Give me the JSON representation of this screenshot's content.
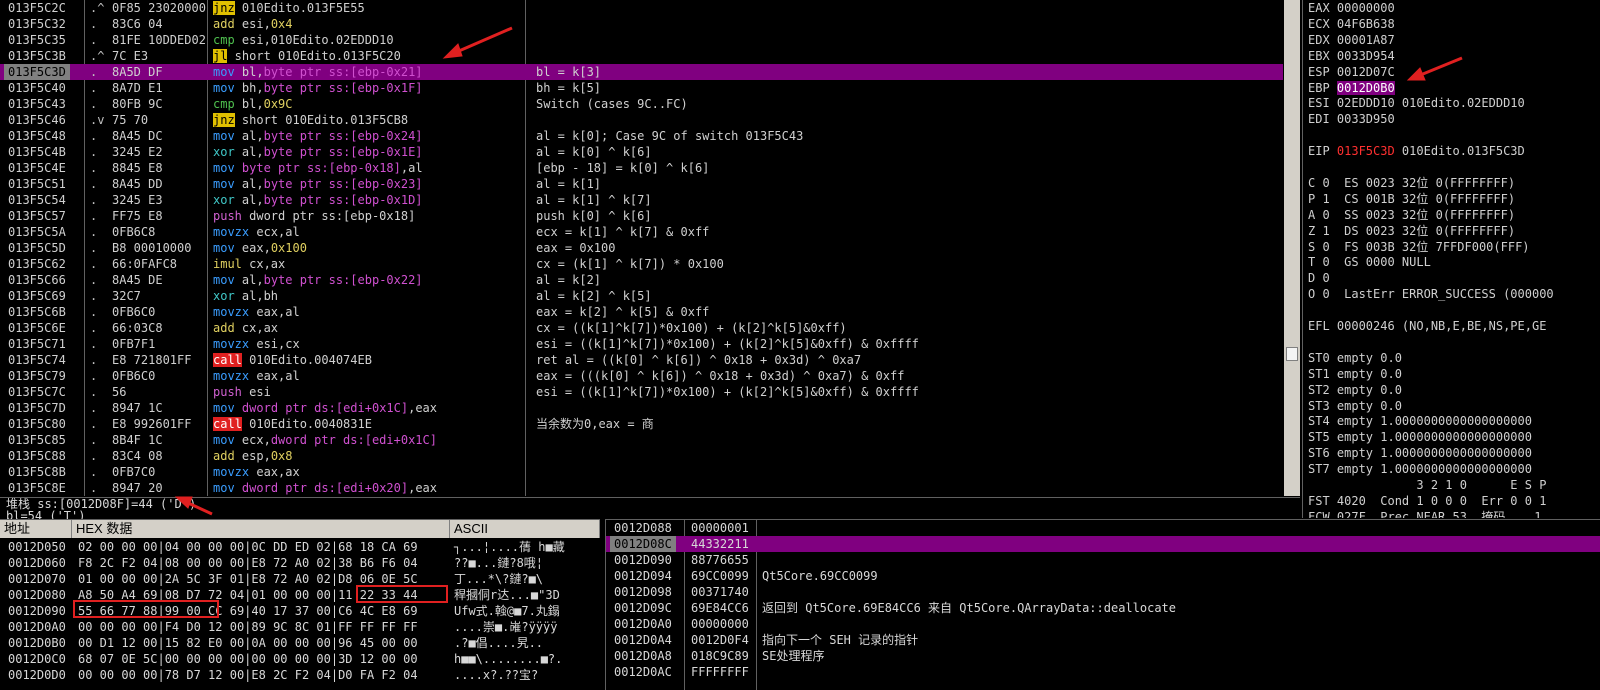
{
  "disasm": {
    "rows": [
      {
        "addr": "013F5C2C",
        "mark": ".^",
        "hex": "0F85 23020000",
        "asm": [
          [
            "jnz",
            "jmp"
          ],
          [
            " 010Edito.013F5E55",
            ""
          ]
        ],
        "cmt": ""
      },
      {
        "addr": "013F5C32",
        "mark": ".",
        "hex": "83C6 04",
        "asm": [
          [
            "add",
            "add"
          ],
          [
            " esi,",
            ""
          ],
          [
            "0x4",
            "imm"
          ]
        ],
        "cmt": ""
      },
      {
        "addr": "013F5C35",
        "mark": ".",
        "hex": "81FE 10DDED02",
        "asm": [
          [
            "cmp",
            "cmp"
          ],
          [
            " esi,010Edito.02EDDD10",
            ""
          ]
        ],
        "cmt": ""
      },
      {
        "addr": "013F5C3B",
        "mark": ".^",
        "hex": "7C E3",
        "asm": [
          [
            "jl",
            "jmp"
          ],
          [
            " short 010Edito.013F5C20",
            ""
          ]
        ],
        "cmt": ""
      },
      {
        "addr": "013F5C3D",
        "mark": ".",
        "hex": "8A5D DF",
        "asm": [
          [
            "mov",
            "mov"
          ],
          [
            " bl,",
            ""
          ],
          [
            "byte ptr ss:[ebp-0x21]",
            "ptr"
          ]
        ],
        "cmt": "bl = k[3]",
        "sel": true
      },
      {
        "addr": "013F5C40",
        "mark": ".",
        "hex": "8A7D E1",
        "asm": [
          [
            "mov",
            "mov"
          ],
          [
            " bh,",
            ""
          ],
          [
            "byte ptr ss:[ebp-0x1F]",
            "ptr"
          ]
        ],
        "cmt": "bh = k[5]"
      },
      {
        "addr": "013F5C43",
        "mark": ".",
        "hex": "80FB 9C",
        "asm": [
          [
            "cmp",
            "cmp"
          ],
          [
            " bl,",
            ""
          ],
          [
            "0x9C",
            "imm"
          ]
        ],
        "cmt": "Switch (cases 9C..FC)"
      },
      {
        "addr": "013F5C46",
        "mark": ".v",
        "hex": "75 70",
        "asm": [
          [
            "jnz",
            "jmp"
          ],
          [
            " short 010Edito.013F5CB8",
            ""
          ]
        ],
        "cmt": ""
      },
      {
        "addr": "013F5C48",
        "mark": ".",
        "hex": "8A45 DC",
        "asm": [
          [
            "mov",
            "mov"
          ],
          [
            " al,",
            ""
          ],
          [
            "byte ptr ss:[ebp-0x24]",
            "ptr"
          ]
        ],
        "cmt": "al = k[0]; Case 9C of switch 013F5C43"
      },
      {
        "addr": "013F5C4B",
        "mark": ".",
        "hex": "3245 E2",
        "asm": [
          [
            "xor",
            "xor"
          ],
          [
            " al,",
            ""
          ],
          [
            "byte ptr ss:[ebp-0x1E]",
            "ptr"
          ]
        ],
        "cmt": "al = k[0] ^ k[6]"
      },
      {
        "addr": "013F5C4E",
        "mark": ".",
        "hex": "8845 E8",
        "asm": [
          [
            "mov",
            "mov"
          ],
          [
            " ",
            ""
          ],
          [
            "byte ptr ss:[ebp-0x18]",
            "ptr"
          ],
          [
            ",al",
            ""
          ]
        ],
        "cmt": "[ebp - 18] = k[0] ^ k[6]"
      },
      {
        "addr": "013F5C51",
        "mark": ".",
        "hex": "8A45 DD",
        "asm": [
          [
            "mov",
            "mov"
          ],
          [
            " al,",
            ""
          ],
          [
            "byte ptr ss:[ebp-0x23]",
            "ptr"
          ]
        ],
        "cmt": "al = k[1]"
      },
      {
        "addr": "013F5C54",
        "mark": ".",
        "hex": "3245 E3",
        "asm": [
          [
            "xor",
            "xor"
          ],
          [
            " al,",
            ""
          ],
          [
            "byte ptr ss:[ebp-0x1D]",
            "ptr"
          ]
        ],
        "cmt": "al = k[1] ^ k[7]"
      },
      {
        "addr": "013F5C57",
        "mark": ".",
        "hex": "FF75 E8",
        "asm": [
          [
            "push",
            "push"
          ],
          [
            " dword ptr ss:[ebp-0x18]",
            ""
          ]
        ],
        "cmt": "push k[0] ^ k[6]"
      },
      {
        "addr": "013F5C5A",
        "mark": ".",
        "hex": "0FB6C8",
        "asm": [
          [
            "movzx",
            "mov"
          ],
          [
            " ecx,al",
            ""
          ]
        ],
        "cmt": "ecx = k[1] ^ k[7] & 0xff"
      },
      {
        "addr": "013F5C5D",
        "mark": ".",
        "hex": "B8 00010000",
        "asm": [
          [
            "mov",
            "mov"
          ],
          [
            " eax,",
            ""
          ],
          [
            "0x100",
            "imm"
          ]
        ],
        "cmt": "eax = 0x100"
      },
      {
        "addr": "013F5C62",
        "mark": ".",
        "hex": "66:0FAFC8",
        "asm": [
          [
            "imul",
            "imul"
          ],
          [
            " cx,ax",
            ""
          ]
        ],
        "cmt": "cx = (k[1] ^ k[7]) * 0x100"
      },
      {
        "addr": "013F5C66",
        "mark": ".",
        "hex": "8A45 DE",
        "asm": [
          [
            "mov",
            "mov"
          ],
          [
            " al,",
            ""
          ],
          [
            "byte ptr ss:[ebp-0x22]",
            "ptr"
          ]
        ],
        "cmt": "al = k[2]"
      },
      {
        "addr": "013F5C69",
        "mark": ".",
        "hex": "32C7",
        "asm": [
          [
            "xor",
            "xor"
          ],
          [
            " al,bh",
            ""
          ]
        ],
        "cmt": "al = k[2] ^ k[5]"
      },
      {
        "addr": "013F5C6B",
        "mark": ".",
        "hex": "0FB6C0",
        "asm": [
          [
            "movzx",
            "mov"
          ],
          [
            " eax,al",
            ""
          ]
        ],
        "cmt": "eax = k[2] ^ k[5] & 0xff"
      },
      {
        "addr": "013F5C6E",
        "mark": ".",
        "hex": "66:03C8",
        "asm": [
          [
            "add",
            "add"
          ],
          [
            " cx,ax",
            ""
          ]
        ],
        "cmt": "cx = ((k[1]^k[7])*0x100) + (k[2]^k[5]&0xff)"
      },
      {
        "addr": "013F5C71",
        "mark": ".",
        "hex": "0FB7F1",
        "asm": [
          [
            "movzx",
            "mov"
          ],
          [
            " esi,cx",
            ""
          ]
        ],
        "cmt": "esi = ((k[1]^k[7])*0x100) + (k[2]^k[5]&0xff) & 0xffff"
      },
      {
        "addr": "013F5C74",
        "mark": ".",
        "hex": "E8 721801FF",
        "asm": [
          [
            "call",
            "call"
          ],
          [
            " 010Edito.004074EB",
            ""
          ]
        ],
        "cmt": "ret al = ((k[0] ^ k[6]) ^ 0x18 + 0x3d) ^ 0xa7"
      },
      {
        "addr": "013F5C79",
        "mark": ".",
        "hex": "0FB6C0",
        "asm": [
          [
            "movzx",
            "mov"
          ],
          [
            " eax,al",
            ""
          ]
        ],
        "cmt": "eax = (((k[0] ^ k[6]) ^ 0x18 + 0x3d) ^ 0xa7) & 0xff"
      },
      {
        "addr": "013F5C7C",
        "mark": ".",
        "hex": "56",
        "asm": [
          [
            "push",
            "push"
          ],
          [
            " esi",
            ""
          ]
        ],
        "cmt": "esi = ((k[1]^k[7])*0x100) + (k[2]^k[5]&0xff) & 0xffff"
      },
      {
        "addr": "013F5C7D",
        "mark": ".",
        "hex": "8947 1C",
        "asm": [
          [
            "mov",
            "mov"
          ],
          [
            " ",
            ""
          ],
          [
            "dword ptr ds:[edi+0x1C]",
            "ptr"
          ],
          [
            ",eax",
            ""
          ]
        ],
        "cmt": ""
      },
      {
        "addr": "013F5C80",
        "mark": ".",
        "hex": "E8 992601FF",
        "asm": [
          [
            "call",
            "call"
          ],
          [
            " 010Edito.0040831E",
            ""
          ]
        ],
        "cmt": "当余数为0,eax = 商"
      },
      {
        "addr": "013F5C85",
        "mark": ".",
        "hex": "8B4F 1C",
        "asm": [
          [
            "mov",
            "mov"
          ],
          [
            " ecx,",
            ""
          ],
          [
            "dword ptr ds:[edi+0x1C]",
            "ptr"
          ]
        ],
        "cmt": ""
      },
      {
        "addr": "013F5C88",
        "mark": ".",
        "hex": "83C4 08",
        "asm": [
          [
            "add",
            "add"
          ],
          [
            " esp,",
            ""
          ],
          [
            "0x8",
            "imm"
          ]
        ],
        "cmt": ""
      },
      {
        "addr": "013F5C8B",
        "mark": ".",
        "hex": "0FB7C0",
        "asm": [
          [
            "movzx",
            "mov"
          ],
          [
            " eax,ax",
            ""
          ]
        ],
        "cmt": ""
      },
      {
        "addr": "013F5C8E",
        "mark": ".",
        "hex": "8947 20",
        "asm": [
          [
            "mov",
            "mov"
          ],
          [
            " ",
            ""
          ],
          [
            "dword ptr ds:[edi+0x20]",
            "ptr"
          ],
          [
            ",eax",
            ""
          ]
        ],
        "cmt": ""
      }
    ]
  },
  "registers": {
    "lines": [
      [
        [
          "EAX 00000000",
          ""
        ]
      ],
      [
        [
          "ECX 04F6B638",
          ""
        ]
      ],
      [
        [
          "EDX 00001A87",
          ""
        ]
      ],
      [
        [
          "EBX 0033D954",
          ""
        ]
      ],
      [
        [
          "ESP 0012D07C",
          ""
        ]
      ],
      [
        [
          "EBP ",
          ""
        ],
        [
          "0012D0B0",
          "hl"
        ]
      ],
      [
        [
          "ESI 02EDDD10 010Edito.02EDDD10",
          ""
        ]
      ],
      [
        [
          "EDI 0033D950",
          ""
        ]
      ],
      [
        [
          "",
          ""
        ]
      ],
      [
        [
          "EIP ",
          ""
        ],
        [
          "013F5C3D",
          "red"
        ],
        [
          " 010Edito.013F5C3D",
          ""
        ]
      ],
      [
        [
          "",
          ""
        ]
      ],
      [
        [
          "C 0  ES 0023 32位 0(FFFFFFFF)",
          ""
        ]
      ],
      [
        [
          "P 1  CS 001B 32位 0(FFFFFFFF)",
          ""
        ]
      ],
      [
        [
          "A 0  SS 0023 32位 0(FFFFFFFF)",
          ""
        ]
      ],
      [
        [
          "Z 1  DS 0023 32位 0(FFFFFFFF)",
          ""
        ]
      ],
      [
        [
          "S 0  FS 003B 32位 7FFDF000(FFF)",
          ""
        ]
      ],
      [
        [
          "T 0  GS 0000 NULL",
          ""
        ]
      ],
      [
        [
          "D 0",
          ""
        ]
      ],
      [
        [
          "O 0  LastErr ERROR_SUCCESS (000000",
          ""
        ]
      ],
      [
        [
          "",
          ""
        ]
      ],
      [
        [
          "EFL 00000246 (NO,NB,E,BE,NS,PE,GE",
          ""
        ]
      ],
      [
        [
          "",
          ""
        ]
      ],
      [
        [
          "ST0 empty 0.0",
          ""
        ]
      ],
      [
        [
          "ST1 empty 0.0",
          ""
        ]
      ],
      [
        [
          "ST2 empty 0.0",
          ""
        ]
      ],
      [
        [
          "ST3 empty 0.0",
          ""
        ]
      ],
      [
        [
          "ST4 empty 1.0000000000000000000",
          ""
        ]
      ],
      [
        [
          "ST5 empty 1.0000000000000000000",
          ""
        ]
      ],
      [
        [
          "ST6 empty 1.0000000000000000000",
          ""
        ]
      ],
      [
        [
          "ST7 empty 1.0000000000000000000",
          ""
        ]
      ],
      [
        [
          "               3 2 1 0      E S P",
          ""
        ]
      ],
      [
        [
          "FST 4020  Cond 1 0 0 0  Err 0 0 1",
          ""
        ]
      ],
      [
        [
          "FCW 027F  Prec NEAR,53  掩码    1",
          ""
        ]
      ]
    ]
  },
  "info": {
    "line1": "堆栈 ss:[0012D08F]=44 ('D')",
    "line2": "bl=54 ('T')"
  },
  "dump": {
    "col_addr": "地址",
    "col_hex": "HEX 数据",
    "col_ascii": "ASCII",
    "rows": [
      {
        "addr": "0012D050",
        "hex": "02 00 00 00|04 00 00 00|0C DD ED 02|68 18 CA 69",
        "ascii": "┐...¦....蒨 h■藏"
      },
      {
        "addr": "0012D060",
        "hex": "F8 2C F2 04|08 00 00 00|E8 72 A0 02|38 B6 F6 04",
        "ascii": "??■...鏈?8哦¦"
      },
      {
        "addr": "0012D070",
        "hex": "01 00 00 00|2A 5C 3F 01|E8 72 A0 02|D8 06 0E 5C",
        "ascii": "丁...*\\?鏈?■\\"
      },
      {
        "addr": "0012D080",
        "hex": "A8 50 A4 69|08 D7 72 04|01 00 00 00|11 22 33 44",
        "ascii": "稈摑侗r达...■\"3D"
      },
      {
        "addr": "0012D090",
        "hex": "55 66 77 88|99 00 CC 69|40 17 37 00|C6 4C E8 69",
        "ascii": "Ufw式.螒@■7.丸鎉"
      },
      {
        "addr": "0012D0A0",
        "hex": "00 00 00 00|F4 D0 12 00|89 9C 8C 01|FF FF FF FF",
        "ascii": "....崇■.嶉?ÿÿÿÿ"
      },
      {
        "addr": "0012D0B0",
        "hex": "00 D1 12 00|15 82 E0 00|0A 00 00 00|96 45 00 00",
        "ascii": ".?■倡....旯.."
      },
      {
        "addr": "0012D0C0",
        "hex": "68 07 0E 5C|00 00 00 00|00 00 00 00|3D 12 00 00",
        "ascii": "h■■\\........■?."
      },
      {
        "addr": "0012D0D0",
        "hex": "00 00 00 00|78 D7 12 00|E8 2C F2 04|D0 FA F2 04",
        "ascii": "....x?.??宝?"
      }
    ]
  },
  "stack": {
    "rows": [
      {
        "addr": "0012D088",
        "val": "00000001",
        "cmt": ""
      },
      {
        "addr": "0012D08C",
        "val": "44332211",
        "cmt": "",
        "sel": true
      },
      {
        "addr": "0012D090",
        "val": "88776655",
        "cmt": ""
      },
      {
        "addr": "0012D094",
        "val": "69CC0099",
        "cmt": "Qt5Core.69CC0099"
      },
      {
        "addr": "0012D098",
        "val": "00371740",
        "cmt": ""
      },
      {
        "addr": "0012D09C",
        "val": "69E84CC6",
        "cmt": "返回到 Qt5Core.69E84CC6 来自 Qt5Core.QArrayData::deallocate"
      },
      {
        "addr": "0012D0A0",
        "val": "00000000",
        "cmt": ""
      },
      {
        "addr": "0012D0A4",
        "val": "0012D0F4",
        "cmt": "指向下一个 SEH 记录的指针"
      },
      {
        "addr": "0012D0A8",
        "val": "018C9C89",
        "cmt": "SE处理程序"
      },
      {
        "addr": "0012D0AC",
        "val": "FFFFFFFF",
        "cmt": ""
      }
    ]
  },
  "colors": {
    "selection": "#800080",
    "annotation": "#e02020",
    "jump": "#e0c000",
    "call": "#e02020"
  }
}
